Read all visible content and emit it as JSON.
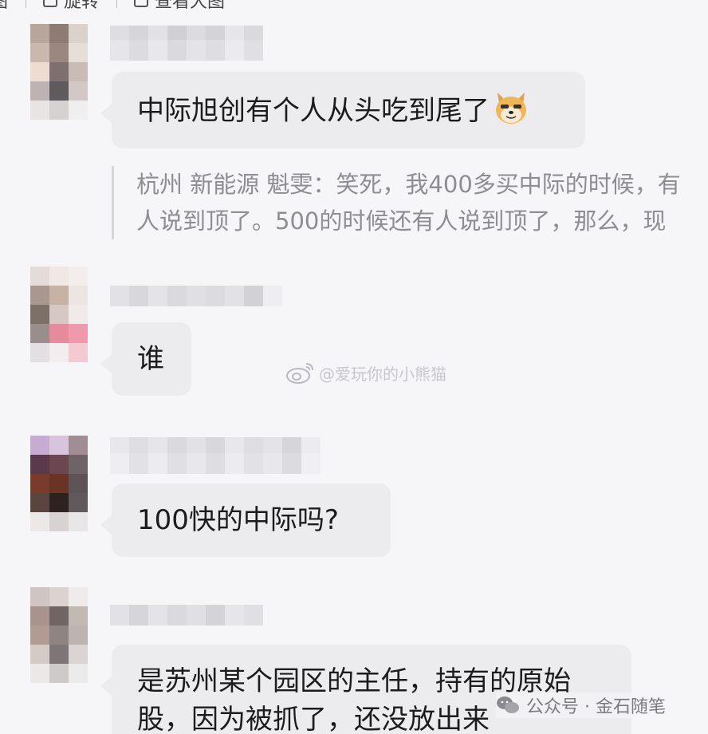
{
  "toolbar": {
    "items": [
      {
        "label": "图",
        "icon": "image-icon"
      },
      {
        "label": "旋转",
        "icon": "rotate-icon"
      },
      {
        "label": "查看大图",
        "icon": "view-large-icon"
      }
    ]
  },
  "messages": [
    {
      "text": "中际旭创有个人从头吃到尾了",
      "emoji": "doge-emoji",
      "quote": {
        "line1": "杭州 新能源 魁雯：笑死，我400多买中际的时候，有",
        "line2": "人说到顶了。500的时候还有人说到顶了，那么，现"
      }
    },
    {
      "text": "谁"
    },
    {
      "text": "100快的中际吗?"
    },
    {
      "text": "是苏州某个园区的主任，持有的原始股，因为被抓了，还没放出来"
    }
  ],
  "watermark": {
    "text": "@爱玩你的小熊猫",
    "icon": "weibo-icon"
  },
  "footer": {
    "text": "公众号 · 金石随笔",
    "icon": "wechat-icon"
  },
  "colors": {
    "background": "#f6f6f8",
    "bubble": "#ececef",
    "quote_text": "#8d8d92",
    "text": "#1c1c1c"
  }
}
